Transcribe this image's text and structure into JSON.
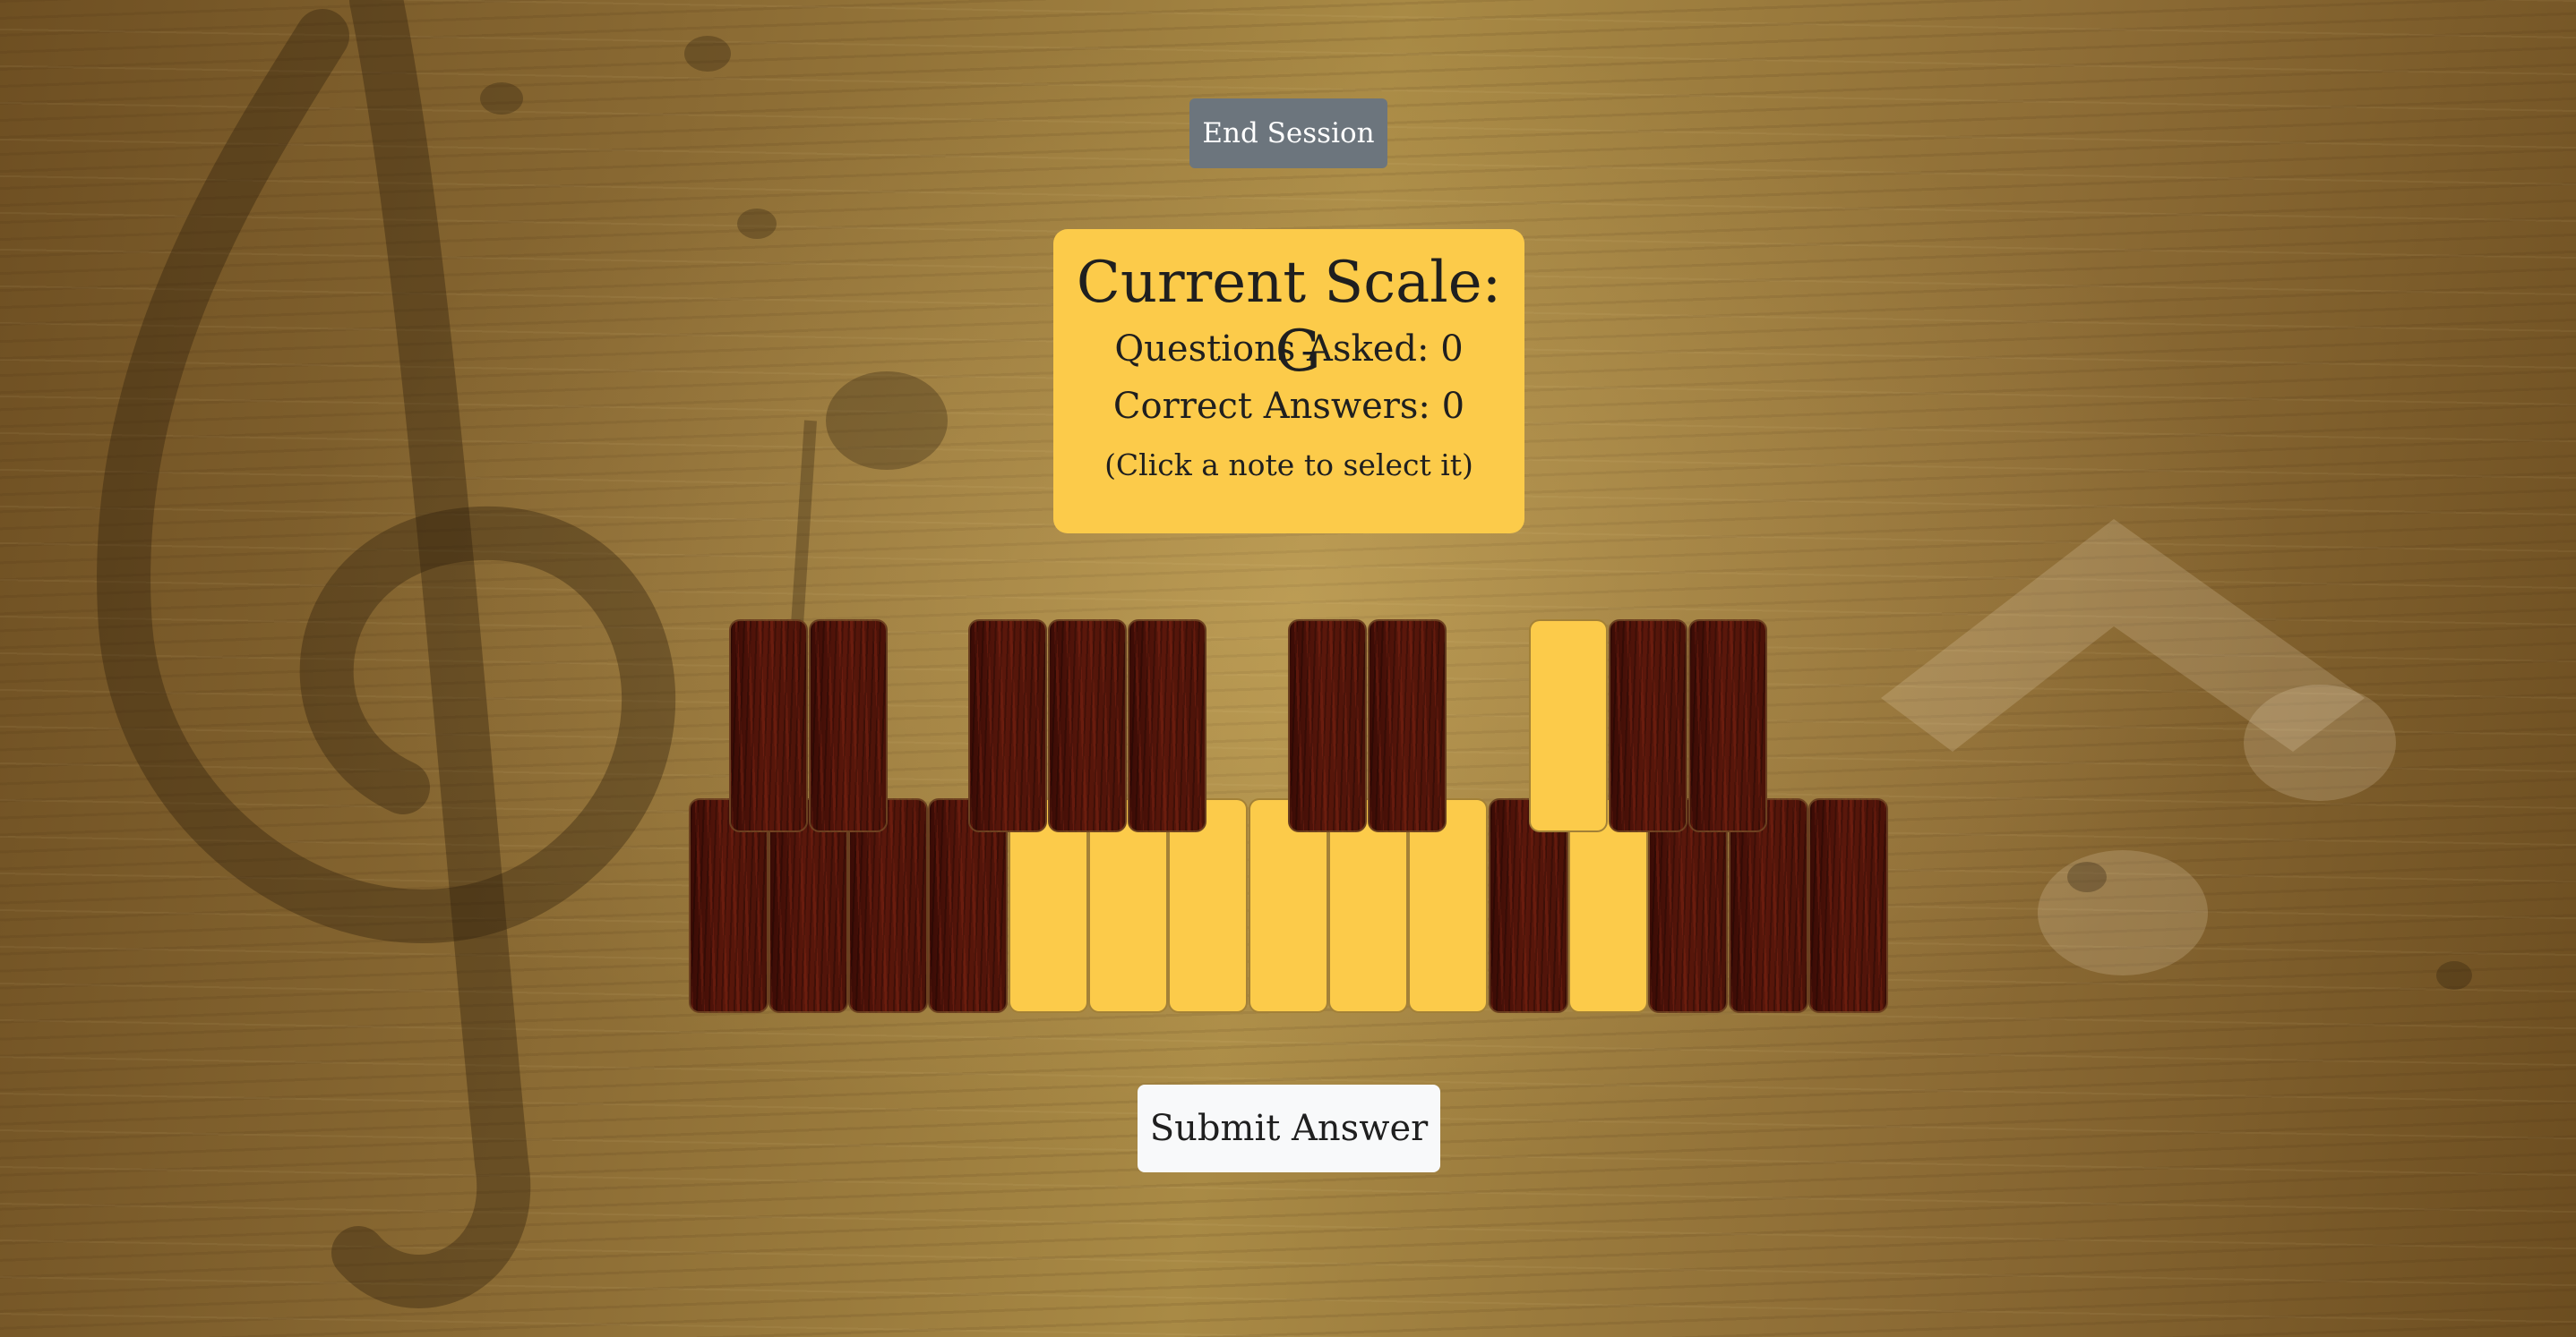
{
  "controls": {
    "end_session_label": "End Session",
    "submit_label": "Submit Answer"
  },
  "card": {
    "scale_prefix": "Current Scale:",
    "scale_value": "G",
    "questions_label": "Questions Asked:",
    "questions_value": "0",
    "correct_label": "Correct Answers:",
    "correct_value": "0",
    "hint": "(Click a note to select it)"
  },
  "keyboard": {
    "upper_row_highlighted": [
      false,
      false,
      false,
      false,
      false,
      false,
      false,
      true,
      false,
      false
    ],
    "lower_row_highlighted": [
      false,
      false,
      false,
      false,
      true,
      true,
      true,
      true,
      true,
      true,
      false,
      true,
      false,
      false,
      false
    ]
  },
  "colors": {
    "highlight": "#fccb4a",
    "key_dark": "#4a1208",
    "end_session_bg": "#6c757d",
    "submit_bg": "#f8f9fa"
  }
}
